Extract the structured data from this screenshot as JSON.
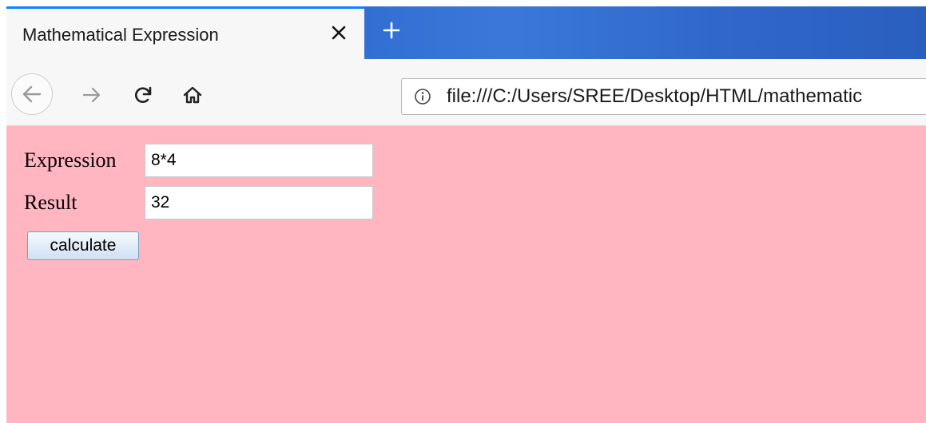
{
  "browser": {
    "tab_title": "Mathematical Expression",
    "url": "file:///C:/Users/SREE/Desktop/HTML/mathematic",
    "accent": "#0a84ff",
    "icons": {
      "tab_close": "close-icon",
      "new_tab": "plus-icon",
      "back": "back-arrow-icon",
      "forward": "forward-arrow-icon",
      "reload": "reload-icon",
      "home": "home-icon",
      "info": "info-icon"
    }
  },
  "page": {
    "background": "#ffb6c1",
    "expression_label": "Expression",
    "expression_value": "8*4",
    "result_label": "Result",
    "result_value": "32",
    "calculate_label": "calculate"
  }
}
